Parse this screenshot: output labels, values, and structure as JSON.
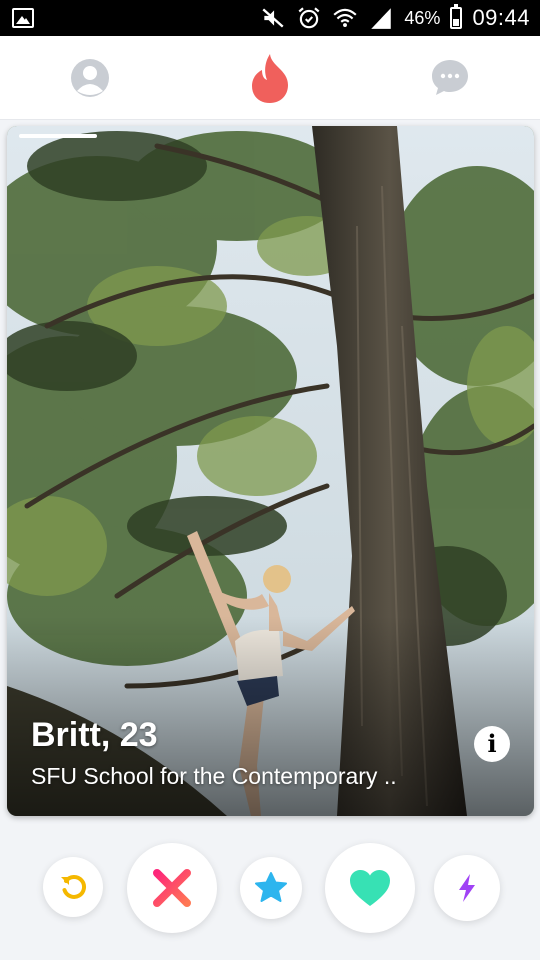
{
  "status_bar": {
    "battery_percent": "46%",
    "battery_level": 0.46,
    "time": "09:44",
    "icons": [
      "gallery-icon",
      "mute-icon",
      "alarm-icon",
      "wifi-icon",
      "signal-icon",
      "battery-icon"
    ]
  },
  "nav": {
    "icons": [
      "profile-icon",
      "flame-icon",
      "messages-icon"
    ],
    "colors": {
      "inactive": "#c9cdd3",
      "flame": "#f0605c"
    }
  },
  "card": {
    "name_age": "Britt, 23",
    "school": "SFU School for the Contemporary ..",
    "info_label": "i",
    "photo_count": 1,
    "current_photo": 1
  },
  "actions": {
    "icons": [
      "rewind-icon",
      "nope-icon",
      "super-like-icon",
      "like-icon",
      "boost-icon"
    ],
    "colors": {
      "rewind": "#f5b800",
      "nope": "#fd5068",
      "super_like": "#2db5ee",
      "like": "#37e1b4",
      "boost": "#a042f5"
    }
  }
}
